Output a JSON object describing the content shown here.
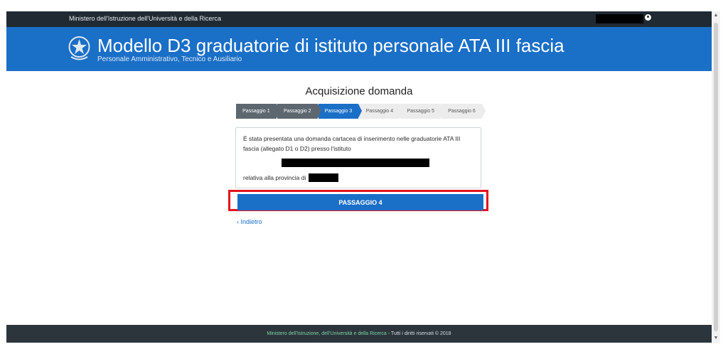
{
  "topbar": {
    "ministry_label": "Ministero dell'Istruzione dell'Università e della Ricerca"
  },
  "header": {
    "title": "Modello D3 graduatorie di istituto personale ATA III fascia",
    "subtitle": "Personale Amministrativo, Tecnico e Ausiliario"
  },
  "main": {
    "heading": "Acquisizione domanda",
    "steps": [
      {
        "label": "Passaggio 1",
        "state": "done"
      },
      {
        "label": "Passaggio 2",
        "state": "done"
      },
      {
        "label": "Passaggio 3",
        "state": "active"
      },
      {
        "label": "Passaggio 4",
        "state": "todo"
      },
      {
        "label": "Passaggio 5",
        "state": "todo"
      },
      {
        "label": "Passaggio 6",
        "state": "todo"
      }
    ],
    "info_text": "È stata presentata una domanda cartacea di inserimento nelle graduatorie ATA III fascia (allegato D1 o D2) presso l'istituto",
    "province_prefix": "relativa alla provincia di",
    "next_button": "PASSAGGIO 4",
    "back_link": "Indietro"
  },
  "footer": {
    "ministry_link": "Ministero dell'Istruzione, dell'Università e della Ricerca",
    "rights": " - Tutti i diritti riservati © 2018"
  },
  "colors": {
    "brand_blue": "#1a6fc7",
    "topbar": "#202a33",
    "highlight_red": "#e3141f"
  },
  "icons": {
    "user": "user-icon",
    "back": "chevron-left-icon",
    "emblem": "republic-emblem-icon"
  }
}
